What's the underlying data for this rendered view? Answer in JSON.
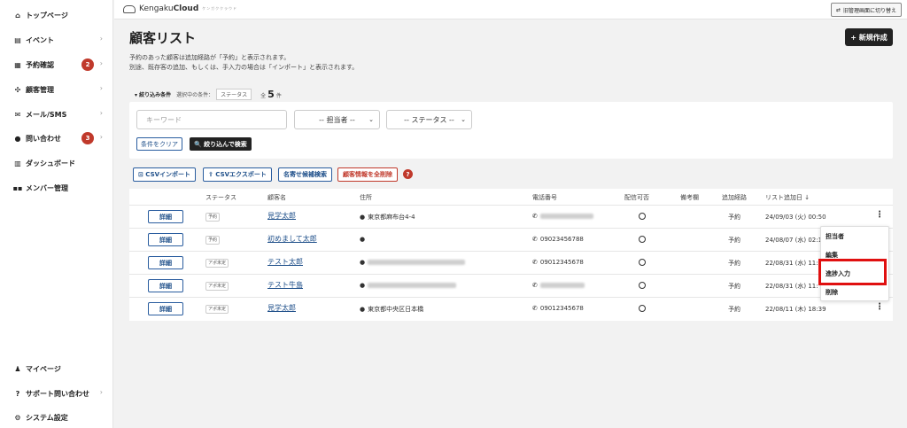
{
  "sidebar": {
    "items": [
      {
        "label": "トップページ",
        "icon": "home-icon",
        "glyph": "⌂",
        "chevron": false
      },
      {
        "label": "イベント",
        "icon": "document-icon",
        "glyph": "▤",
        "chevron": true
      },
      {
        "label": "予約確認",
        "icon": "calendar-icon",
        "glyph": "▦",
        "chevron": true,
        "badge": "2"
      },
      {
        "label": "顧客管理",
        "icon": "users-icon",
        "glyph": "✣",
        "chevron": true
      },
      {
        "label": "メール/SMS",
        "icon": "mail-icon",
        "glyph": "✉",
        "chevron": true
      },
      {
        "label": "問い合わせ",
        "icon": "chat-icon",
        "glyph": "●",
        "chevron": true,
        "badge": "3"
      },
      {
        "label": "ダッシュボード",
        "icon": "chart-icon",
        "glyph": "▥",
        "chevron": false
      },
      {
        "label": "メンバー管理",
        "icon": "grid-icon",
        "glyph": "▪▪",
        "chevron": false
      }
    ],
    "bottom": [
      {
        "label": "マイページ",
        "icon": "person-icon",
        "glyph": "♟",
        "chevron": false
      },
      {
        "label": "サポート問い合わせ",
        "icon": "help-icon",
        "glyph": "?",
        "chevron": true
      },
      {
        "label": "システム設定",
        "icon": "gear-icon",
        "glyph": "⚙",
        "chevron": false
      }
    ]
  },
  "topbar": {
    "brand": "KengakuCloud",
    "brand_plain": "Kengaku",
    "brand_bold": "Cloud",
    "tagline": "ケンガククラウド",
    "switch_label": "旧管理画面に切り替え"
  },
  "header": {
    "title": "顧客リスト",
    "new_button": "+ 新規作成",
    "desc_line1": "予約のあった顧客は追加経路が「予約」と表示されます。",
    "desc_line2": "別途、既存客の追加、もしくは、手入力の場合は「インポート」と表示されます。"
  },
  "filter": {
    "label": "▾ 絞り込み条件",
    "selected_label": "選択中の条件：",
    "selected_chip": "ステータス",
    "count_prefix": "全",
    "count": "5",
    "count_suffix": "件",
    "keyword_placeholder": "キーワード",
    "assignee_select": "-- 担当者 --",
    "status_select": "-- ステータス --",
    "clear_button": "条件をクリア",
    "search_button": "🔍 絞り込んで検索"
  },
  "actions": {
    "csv_import": "⊡ CSVインポート",
    "csv_export": "⇪ CSVエクスポート",
    "duplicate_search": "名寄せ候補検索",
    "delete_all": "顧客情報を全削除",
    "help": "?"
  },
  "table": {
    "headers": [
      "ステータス",
      "顧客名",
      "住所",
      "電話番号",
      "配信可否",
      "備考欄",
      "追加経路",
      "リスト追加日 ↓"
    ],
    "detail_label": "詳細",
    "rows": [
      {
        "status": "予約",
        "name": "見学太郎",
        "address": "東京都麻布台4-4",
        "phone": "",
        "route": "予約",
        "date": "24/09/03 (火) 00:50"
      },
      {
        "status": "予約",
        "name": "初めまして太郎",
        "address": "",
        "phone": "09023456788",
        "route": "予約",
        "date": "24/08/07 (水) 02:1"
      },
      {
        "status": "アポ未定",
        "name": "テスト太郎",
        "address": "",
        "phone": "09012345678",
        "route": "予約",
        "date": "22/08/31 (水) 11:"
      },
      {
        "status": "アポ未定",
        "name": "テスト牛島",
        "address": "",
        "phone": "",
        "route": "予約",
        "date": "22/08/31 (水) 11:"
      },
      {
        "status": "アポ未定",
        "name": "見学太郎",
        "address": "東京都中央区日本橋",
        "phone": "09012345678",
        "route": "予約",
        "date": "22/08/11 (木) 18:39"
      }
    ]
  },
  "context_menu": {
    "items": [
      "担当者",
      "編集",
      "進捗入力",
      "削除"
    ],
    "highlighted": "進捗入力",
    "highlight_color": "#e01010"
  },
  "colors": {
    "accent": "#1d4e89",
    "danger": "#c0392b",
    "dark": "#222222"
  }
}
